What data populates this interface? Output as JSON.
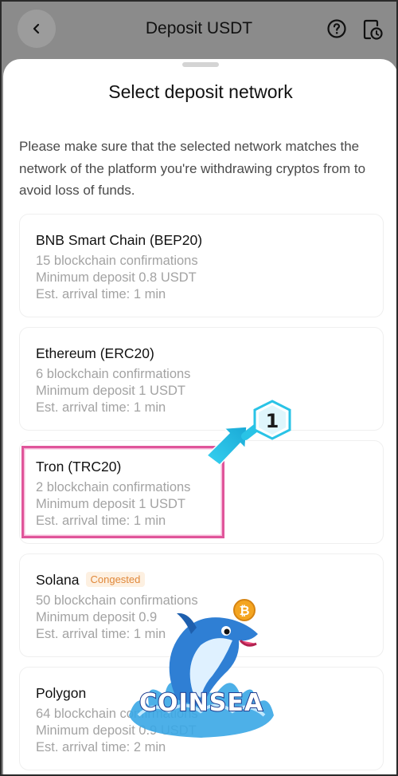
{
  "header": {
    "title": "Deposit USDT",
    "back_icon": "chevron-left-icon",
    "help_icon": "help-circle-icon",
    "history_icon": "document-clock-icon"
  },
  "sheet": {
    "title": "Select deposit network",
    "notice": "Please make sure that the selected network matches the network of the platform you're withdrawing cryptos from to avoid loss of funds."
  },
  "networks": [
    {
      "name": "BNB Smart Chain (BEP20)",
      "confirmations": "15 blockchain confirmations",
      "min_deposit": "Minimum deposit 0.8 USDT",
      "arrival": "Est. arrival time: 1 min"
    },
    {
      "name": "Ethereum (ERC20)",
      "confirmations": "6 blockchain confirmations",
      "min_deposit": "Minimum deposit 1 USDT",
      "arrival": "Est. arrival time: 1 min"
    },
    {
      "name": "Tron (TRC20)",
      "confirmations": "2 blockchain confirmations",
      "min_deposit": "Minimum deposit 1 USDT",
      "arrival": "Est. arrival time: 1 min"
    },
    {
      "name": "Solana",
      "badge": "Congested",
      "confirmations": "50 blockchain confirmations",
      "min_deposit": "Minimum deposit 0.9",
      "arrival": "Est. arrival time: 1 min"
    },
    {
      "name": "Polygon",
      "confirmations": "64 blockchain confirmations",
      "min_deposit": "Minimum deposit 0.9 USDT",
      "arrival": "Est. arrival time: 2 min"
    }
  ],
  "annotation": {
    "step_number": "1",
    "arrow_color": "#29c3e6",
    "highlight_color": "#e0559a"
  },
  "watermark": {
    "text": "COINSEA",
    "coin_symbol": "₿"
  },
  "colors": {
    "overlay": "#8b8b8b",
    "muted_text": "#a3a3a3",
    "badge_text": "#e0883a",
    "badge_bg": "#fdf0e1"
  }
}
